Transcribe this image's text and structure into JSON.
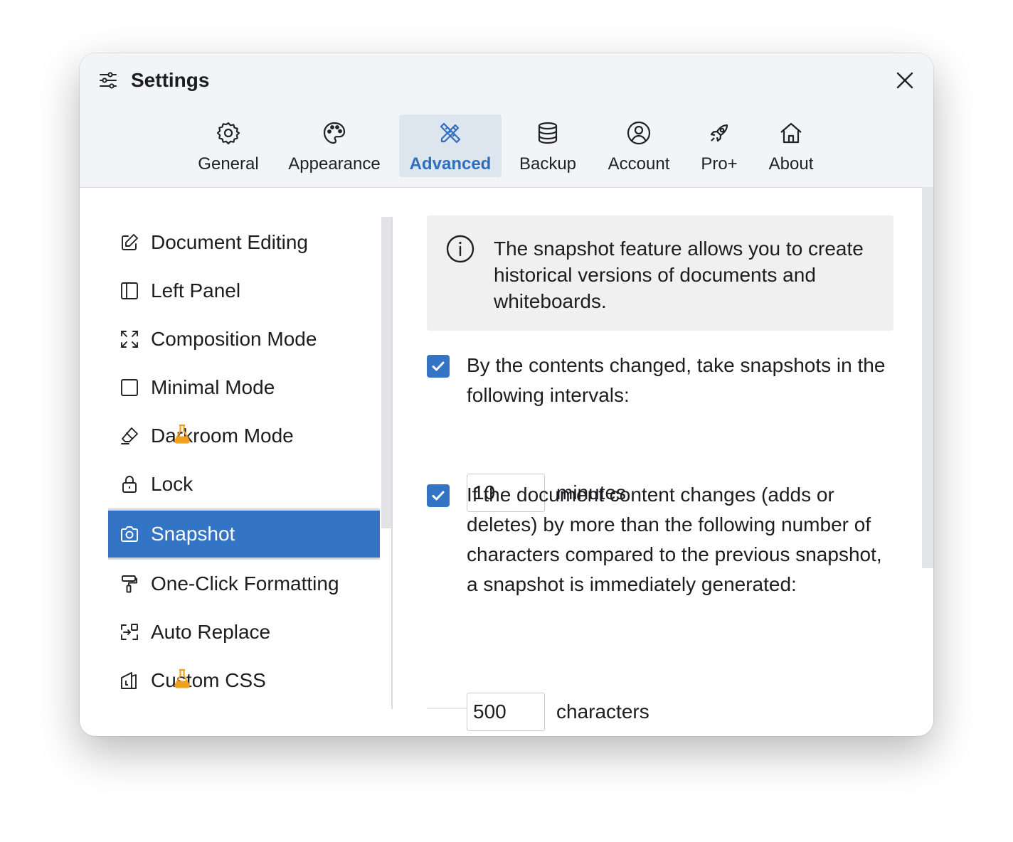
{
  "window": {
    "title": "Settings",
    "close_icon": "close-icon"
  },
  "tabs": [
    {
      "id": "general",
      "label": "General",
      "icon": "gear-icon",
      "active": false
    },
    {
      "id": "appearance",
      "label": "Appearance",
      "icon": "palette-icon",
      "active": false
    },
    {
      "id": "advanced",
      "label": "Advanced",
      "icon": "pencil-ruler-icon",
      "active": true
    },
    {
      "id": "backup",
      "label": "Backup",
      "icon": "database-icon",
      "active": false
    },
    {
      "id": "account",
      "label": "Account",
      "icon": "user-circle-icon",
      "active": false
    },
    {
      "id": "pro",
      "label": "Pro+",
      "icon": "rocket-icon",
      "active": false
    },
    {
      "id": "about",
      "label": "About",
      "icon": "home-icon",
      "active": false
    }
  ],
  "sidebar": {
    "items": [
      {
        "label": "Document Editing",
        "icon": "edit-icon",
        "active": false,
        "experimental": false
      },
      {
        "label": "Left Panel",
        "icon": "panel-left-icon",
        "active": false,
        "experimental": false
      },
      {
        "label": "Composition Mode",
        "icon": "expand-icon",
        "active": false,
        "experimental": false
      },
      {
        "label": "Minimal Mode",
        "icon": "square-icon",
        "active": false,
        "experimental": false
      },
      {
        "label": "Darkroom Mode",
        "icon": "eraser-icon",
        "active": false,
        "experimental": true
      },
      {
        "label": "Lock",
        "icon": "lock-icon",
        "active": false,
        "experimental": false
      },
      {
        "label": "Snapshot",
        "icon": "camera-icon",
        "active": true,
        "experimental": false
      },
      {
        "label": "One-Click Formatting",
        "icon": "paint-roller-icon",
        "active": false,
        "experimental": false
      },
      {
        "label": "Auto Replace",
        "icon": "replace-icon",
        "active": false,
        "experimental": false
      },
      {
        "label": "Custom CSS",
        "icon": "css-icon",
        "active": false,
        "experimental": true
      }
    ]
  },
  "content": {
    "info": {
      "icon": "info-icon",
      "text": "The snapshot feature allows you to create historical versions of documents and whiteboards."
    },
    "interval_option": {
      "checked": true,
      "text": "By the contents changed, take snapshots in the following intervals:",
      "value": "10",
      "unit": "minutes"
    },
    "chars_option": {
      "checked": true,
      "text": "If the document content changes (adds or deletes) by more than the following number of characters compared to the previous snapshot, a snapshot is immediately generated:",
      "value": "500",
      "unit": "characters"
    }
  },
  "colors": {
    "accent": "#3375c4",
    "active_tab_bg": "#dde5ef",
    "header_bg": "#f3f4f6",
    "experimental_badge": "#f0a020"
  }
}
